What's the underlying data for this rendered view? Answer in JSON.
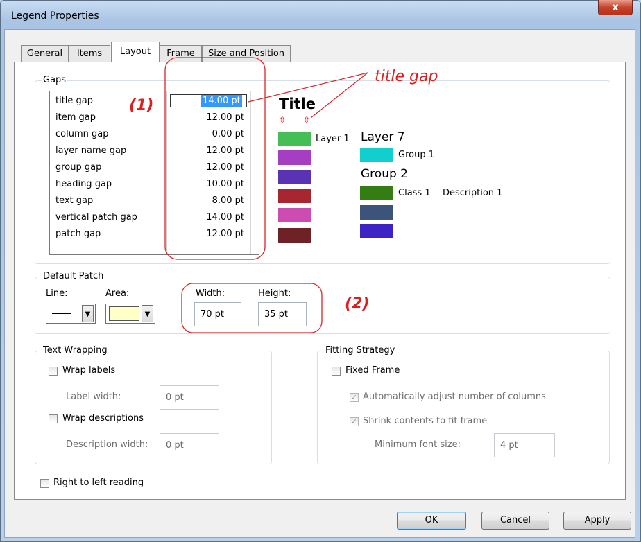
{
  "window": {
    "title": "Legend Properties",
    "close_label": "x"
  },
  "tabs": [
    {
      "label": "General"
    },
    {
      "label": "Items"
    },
    {
      "label": "Layout"
    },
    {
      "label": "Frame"
    },
    {
      "label": "Size and Position"
    }
  ],
  "gaps": {
    "label": "Gaps",
    "rows": [
      {
        "name": "title gap",
        "value": "14.00 pt"
      },
      {
        "name": "item gap",
        "value": "12.00 pt"
      },
      {
        "name": "column gap",
        "value": "0.00 pt"
      },
      {
        "name": "layer name gap",
        "value": "12.00 pt"
      },
      {
        "name": "group gap",
        "value": "12.00 pt"
      },
      {
        "name": "heading gap",
        "value": "10.00 pt"
      },
      {
        "name": "text gap",
        "value": "8.00 pt"
      },
      {
        "name": "vertical patch gap",
        "value": "14.00 pt"
      },
      {
        "name": "patch gap",
        "value": "12.00 pt"
      }
    ],
    "annotation_1": "(1)",
    "callout": "title gap"
  },
  "preview": {
    "title": "Title",
    "layer1": "Layer 1",
    "layer7": "Layer 7",
    "group1": "Group 1",
    "group2": "Group 2",
    "class1": "Class 1",
    "description1": "Description 1",
    "left_patch_colors": [
      "#45be56",
      "#a63ec2",
      "#5a32b4",
      "#a8262f",
      "#cc4cb2",
      "#6e2226"
    ],
    "right_patch_colors": [
      "#11cfcf",
      "#347d12",
      "#3c5479",
      "#3d22c4"
    ]
  },
  "default_patch": {
    "label": "Default Patch",
    "line_label": "Line:",
    "area_label": "Area:",
    "width_label": "Width:",
    "height_label": "Height:",
    "width_value": "70 pt",
    "height_value": "35 pt",
    "area_color": "#ffffc8",
    "annotation_2": "(2)"
  },
  "text_wrapping": {
    "label": "Text Wrapping",
    "wrap_labels": "Wrap labels",
    "label_width": "Label width:",
    "label_width_value": "0 pt",
    "wrap_descriptions": "Wrap descriptions",
    "description_width": "Description width:",
    "description_width_value": "0 pt"
  },
  "fitting": {
    "label": "Fitting Strategy",
    "fixed_frame": "Fixed Frame",
    "auto_adjust": "Automatically adjust number of columns",
    "shrink": "Shrink contents to fit frame",
    "min_font_size": "Minimum font size:",
    "min_font_value": "4 pt"
  },
  "rtl_reading": "Right to left reading",
  "buttons": {
    "ok": "OK",
    "cancel": "Cancel",
    "apply": "Apply"
  }
}
